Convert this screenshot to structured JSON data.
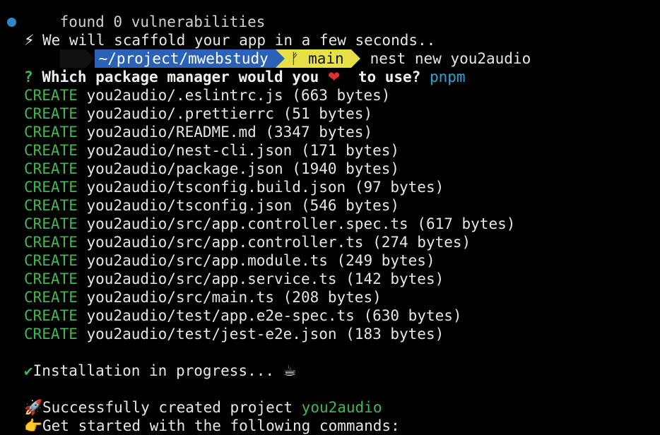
{
  "cut_top_text": "found 0 vulnerabilities",
  "prompt": {
    "directory": "~/project/mwebstudy",
    "git_branch_icon": "branch-icon",
    "git_branch": "main",
    "command": "nest new you2audio"
  },
  "scaffold_message": "We will scaffold your app in a few seconds..",
  "question": {
    "mark": "?",
    "text_before": "Which package manager would you",
    "text_after": "to use?",
    "answer": "pnpm"
  },
  "create_label": "CREATE",
  "created_files": [
    "you2audio/.eslintrc.js (663 bytes)",
    "you2audio/.prettierrc (51 bytes)",
    "you2audio/README.md (3347 bytes)",
    "you2audio/nest-cli.json (171 bytes)",
    "you2audio/package.json (1940 bytes)",
    "you2audio/tsconfig.build.json (97 bytes)",
    "you2audio/tsconfig.json (546 bytes)",
    "you2audio/src/app.controller.spec.ts (617 bytes)",
    "you2audio/src/app.controller.ts (274 bytes)",
    "you2audio/src/app.module.ts (249 bytes)",
    "you2audio/src/app.service.ts (142 bytes)",
    "you2audio/src/main.ts (208 bytes)",
    "you2audio/test/app.e2e-spec.ts (630 bytes)",
    "you2audio/test/jest-e2e.json (183 bytes)"
  ],
  "installation": {
    "check": "✔",
    "text": "Installation in progress..."
  },
  "success": {
    "text": "Successfully created project",
    "project": "you2audio"
  },
  "get_started": "Get started with the following commands:",
  "colors": {
    "background": "#000000",
    "create_green": "#3fb950",
    "answer_cyan": "#29a4d6",
    "dir_segment": "#2b62b7",
    "git_segment": "#e8e047",
    "status_dot": "#2f86c0"
  }
}
